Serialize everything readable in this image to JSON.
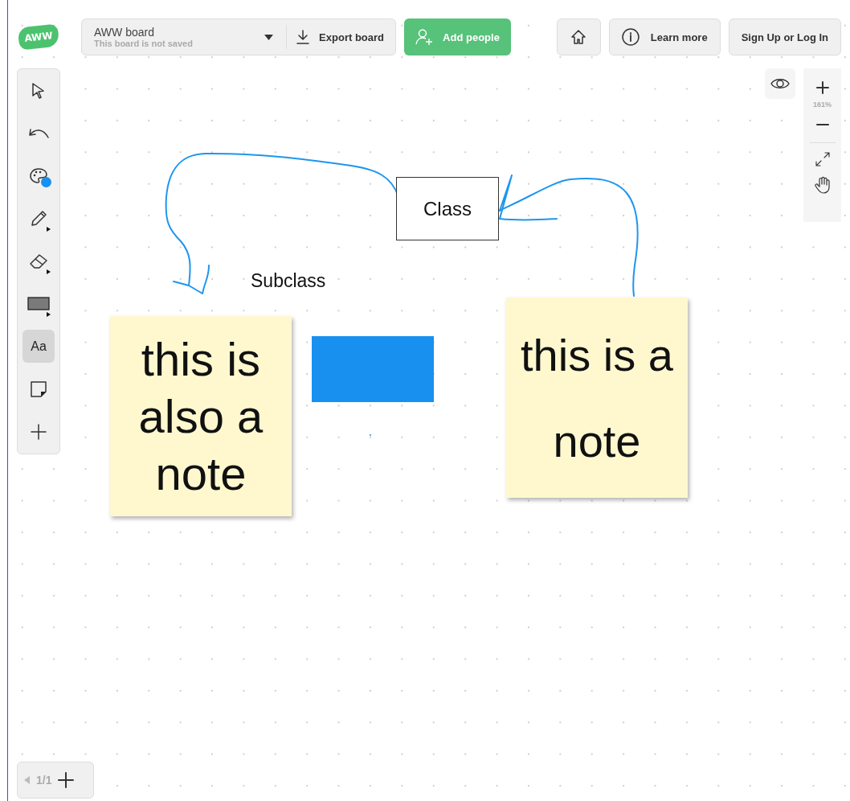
{
  "logo": {
    "text": "AWW"
  },
  "board": {
    "title": "AWW board",
    "status": "This board is not saved"
  },
  "header_buttons": [
    {
      "kind": "home"
    },
    {
      "kind": "info",
      "label": "Learn more"
    },
    {
      "kind": "plain",
      "label": "Sign Up or Log In"
    }
  ],
  "export_button": {
    "label": "Export board"
  },
  "add_people_button": {
    "label": "Add people"
  },
  "tools": [
    {
      "kind": "select",
      "selected": false
    },
    {
      "kind": "undo",
      "selected": false
    },
    {
      "kind": "palette",
      "selected": false,
      "color": "#1890f0"
    },
    {
      "kind": "pencil",
      "selected": false
    },
    {
      "kind": "eraser",
      "selected": false
    },
    {
      "kind": "shape",
      "selected": false
    },
    {
      "kind": "text",
      "label": "Aa",
      "selected": true
    },
    {
      "kind": "note",
      "selected": false
    },
    {
      "kind": "add",
      "selected": false
    }
  ],
  "zoom": {
    "level_text": "161%"
  },
  "canvas": {
    "items": [
      {
        "kind": "box",
        "text": "Class"
      },
      {
        "kind": "label",
        "text": "Subclass"
      },
      {
        "kind": "note",
        "text": "this is also a note"
      },
      {
        "kind": "rect",
        "color": "#1890f0"
      },
      {
        "kind": "note",
        "text": "this is a note"
      }
    ]
  },
  "pager": {
    "text": "1/1"
  }
}
